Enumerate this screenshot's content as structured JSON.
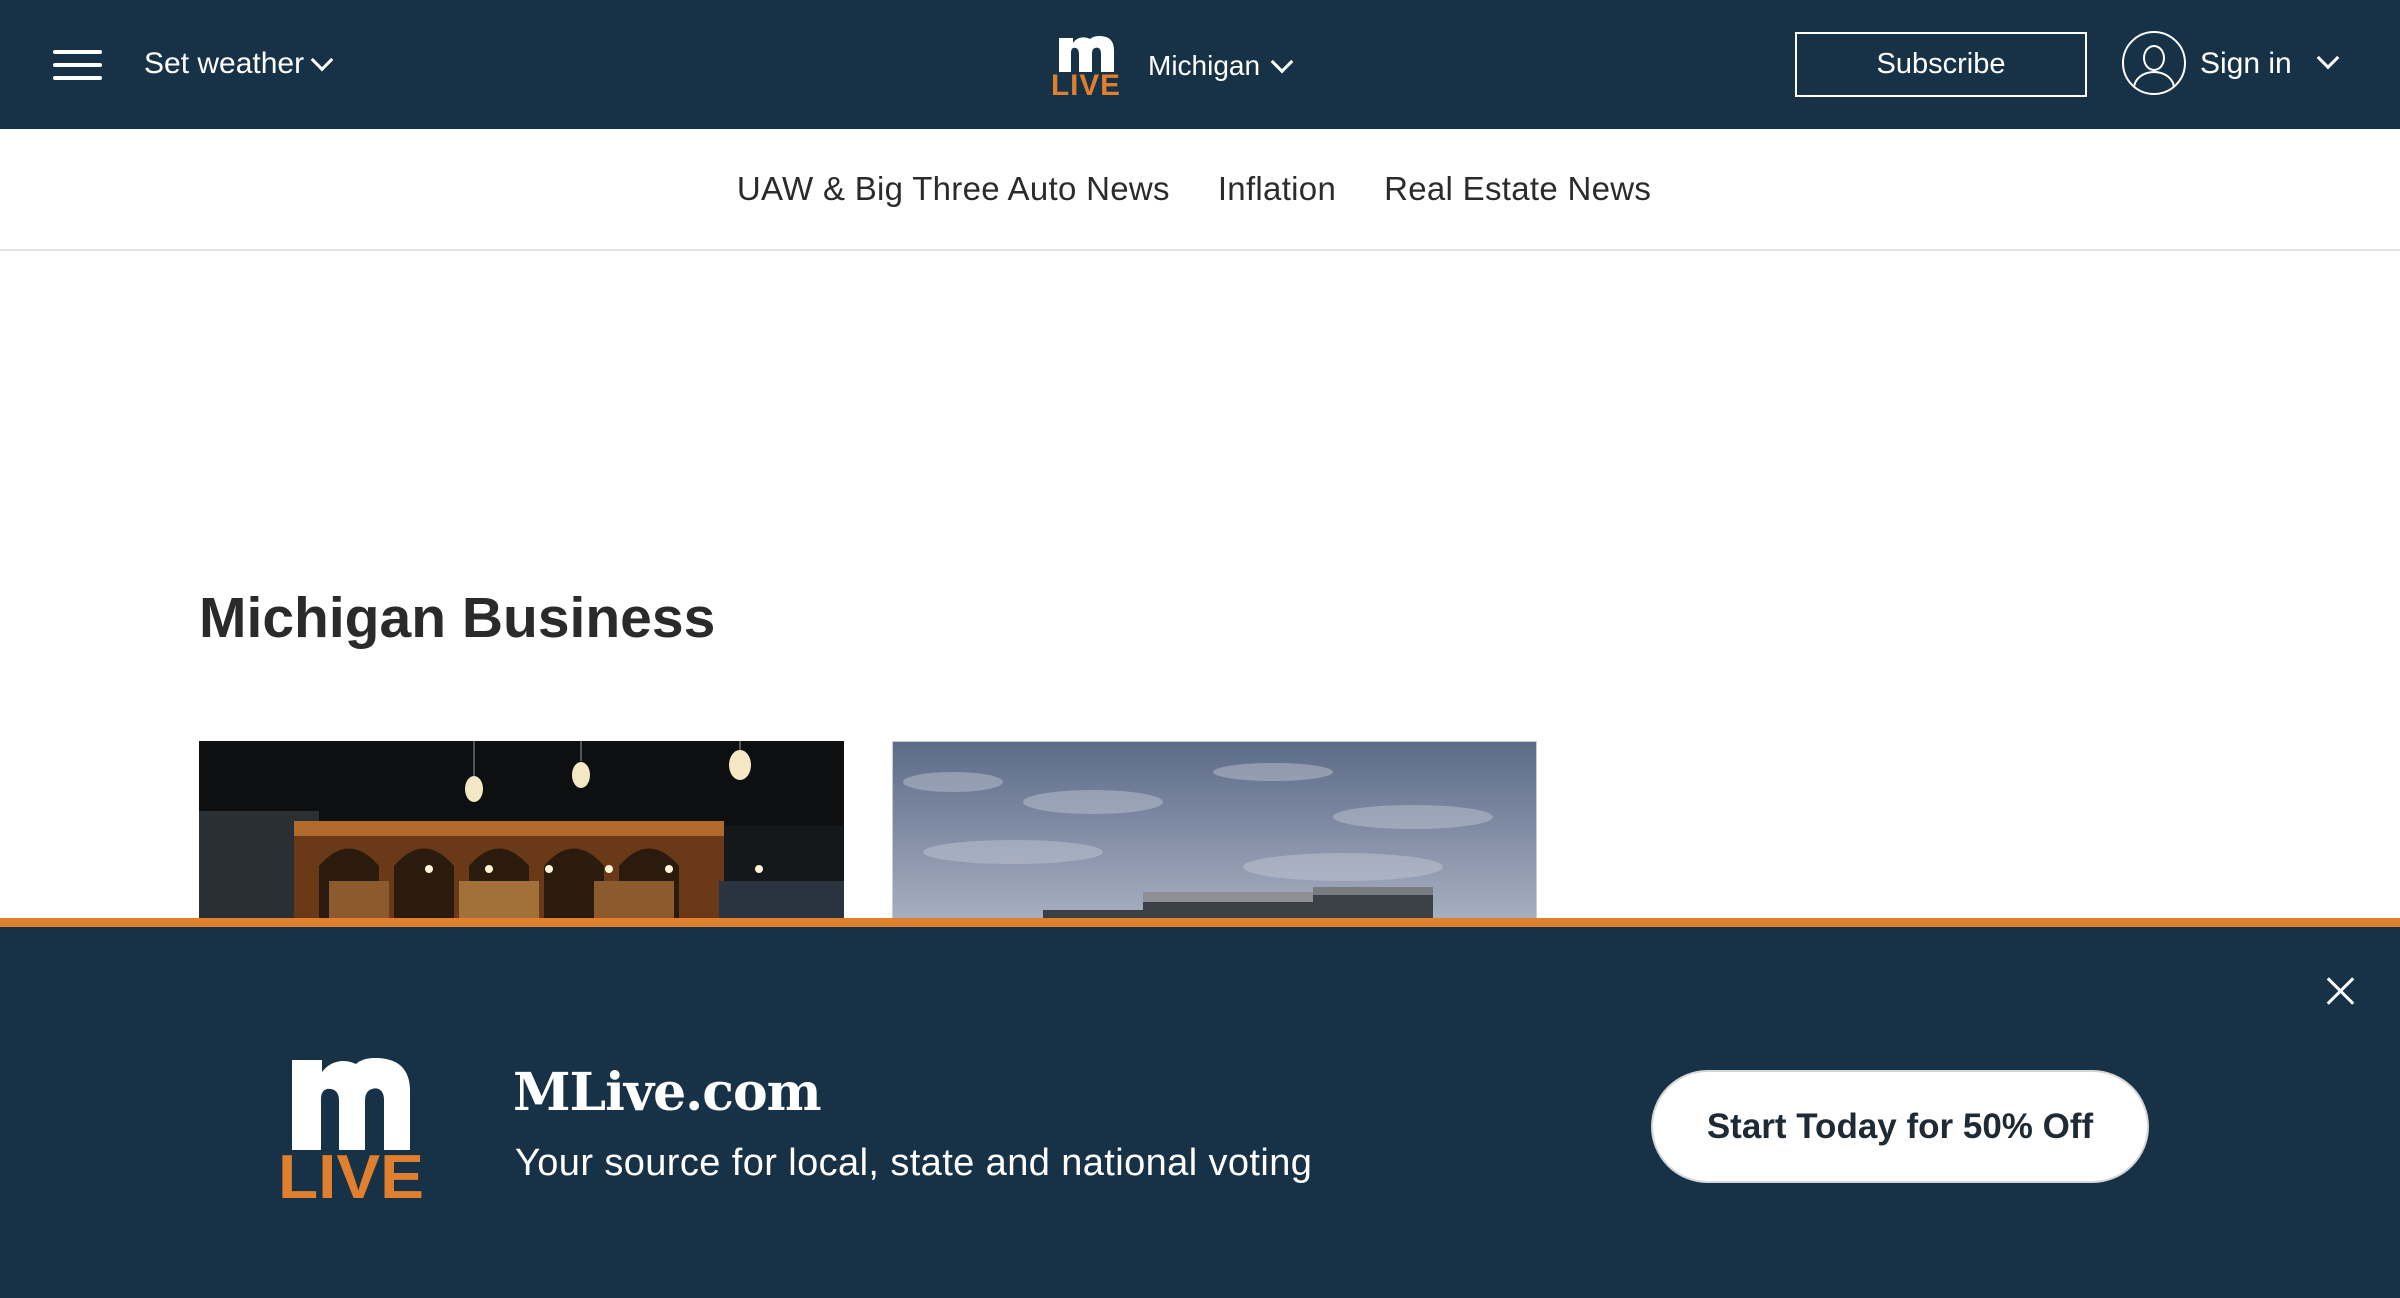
{
  "header": {
    "weather_label": "Set weather",
    "logo": {
      "top": "m",
      "bottom": "LIVE"
    },
    "region_label": "Michigan",
    "subscribe_label": "Subscribe",
    "signin_label": "Sign in"
  },
  "topics": [
    {
      "label": "UAW & Big Three Auto News"
    },
    {
      "label": "Inflation"
    },
    {
      "label": "Real Estate News"
    }
  ],
  "section": {
    "title": "Michigan Business"
  },
  "banner": {
    "logo": {
      "top": "m",
      "bottom": "LIVE"
    },
    "brand": "MLive.com",
    "tagline": "Your source for local, state and national voting",
    "cta_label": "Start Today for 50% Off"
  },
  "colors": {
    "navy": "#173247",
    "orange_accent": "#e07f2e",
    "white": "#ffffff"
  },
  "icons": [
    "menu-icon",
    "chevron-down-icon",
    "user-avatar-icon",
    "close-icon"
  ]
}
